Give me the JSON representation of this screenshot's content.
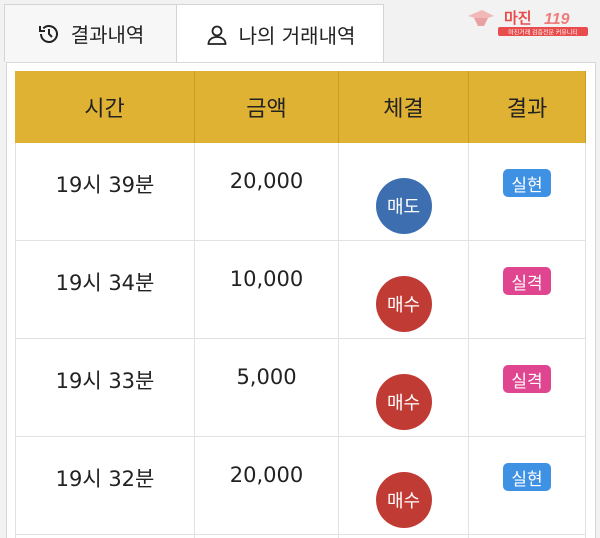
{
  "tabs": [
    {
      "label": "결과내역",
      "icon": "history-icon"
    },
    {
      "label": "나의 거래내역",
      "icon": "user-icon"
    }
  ],
  "logo": {
    "text": "마진",
    "tagline": "마진거래 검증전문 커뮤니티",
    "accent": "#e84c4c"
  },
  "table": {
    "headers": [
      "시간",
      "금액",
      "체결",
      "결과"
    ],
    "header_color": "#e0b233",
    "rows": [
      {
        "time": "19시 39분",
        "amount": "20,000",
        "execution": "매도",
        "result": "실현"
      },
      {
        "time": "19시 34분",
        "amount": "10,000",
        "execution": "매수",
        "result": "실격"
      },
      {
        "time": "19시 33분",
        "amount": "5,000",
        "execution": "매수",
        "result": "실격"
      },
      {
        "time": "19시 32분",
        "amount": "20,000",
        "execution": "매수",
        "result": "실현"
      }
    ]
  },
  "colors": {
    "sell": "#3d6fb0",
    "buy": "#c13b35",
    "win": "#3f91e4",
    "lose": "#e0468f"
  }
}
